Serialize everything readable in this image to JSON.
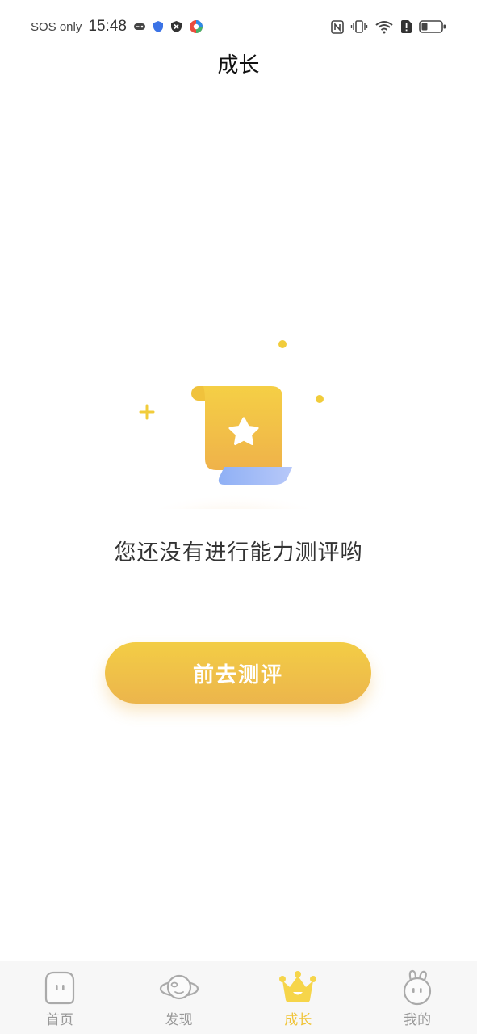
{
  "status_bar": {
    "carrier": "SOS only",
    "time": "15:48"
  },
  "header": {
    "title": "成长"
  },
  "empty_state": {
    "message": "您还没有进行能力测评哟",
    "button_label": "前去测评"
  },
  "tabs": [
    {
      "label": "首页",
      "icon": "home-face-icon",
      "active": false
    },
    {
      "label": "发现",
      "icon": "planet-icon",
      "active": false
    },
    {
      "label": "成长",
      "icon": "crown-icon",
      "active": true
    },
    {
      "label": "我的",
      "icon": "bunny-icon",
      "active": false
    }
  ],
  "colors": {
    "accent": "#f0c438",
    "button_top": "#f3cd45",
    "button_bottom": "#ecb54c",
    "inactive_tab": "#999999"
  }
}
